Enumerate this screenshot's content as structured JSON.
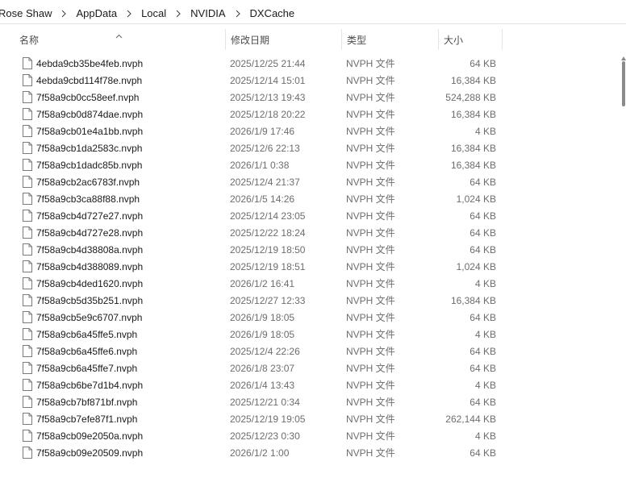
{
  "breadcrumb": [
    "Rose Shaw",
    "AppData",
    "Local",
    "NVIDIA",
    "DXCache"
  ],
  "columns": {
    "name": "名称",
    "date": "修改日期",
    "type": "类型",
    "size": "大小"
  },
  "files": [
    {
      "name": "4ebda9cb35be4feb.nvph",
      "date": "2025/12/25 21:44",
      "type": "NVPH 文件",
      "size": "64 KB"
    },
    {
      "name": "4ebda9cbd114f78e.nvph",
      "date": "2025/12/14 15:01",
      "type": "NVPH 文件",
      "size": "16,384 KB"
    },
    {
      "name": "7f58a9cb0cc58eef.nvph",
      "date": "2025/12/13 19:43",
      "type": "NVPH 文件",
      "size": "524,288 KB"
    },
    {
      "name": "7f58a9cb0d874dae.nvph",
      "date": "2025/12/18 20:22",
      "type": "NVPH 文件",
      "size": "16,384 KB"
    },
    {
      "name": "7f58a9cb01e4a1bb.nvph",
      "date": "2026/1/9 17:46",
      "type": "NVPH 文件",
      "size": "4 KB"
    },
    {
      "name": "7f58a9cb1da2583c.nvph",
      "date": "2025/12/6 22:13",
      "type": "NVPH 文件",
      "size": "16,384 KB"
    },
    {
      "name": "7f58a9cb1dadc85b.nvph",
      "date": "2026/1/1 0:38",
      "type": "NVPH 文件",
      "size": "16,384 KB"
    },
    {
      "name": "7f58a9cb2ac6783f.nvph",
      "date": "2025/12/4 21:37",
      "type": "NVPH 文件",
      "size": "64 KB"
    },
    {
      "name": "7f58a9cb3ca88f88.nvph",
      "date": "2026/1/5 14:26",
      "type": "NVPH 文件",
      "size": "1,024 KB"
    },
    {
      "name": "7f58a9cb4d727e27.nvph",
      "date": "2025/12/14 23:05",
      "type": "NVPH 文件",
      "size": "64 KB"
    },
    {
      "name": "7f58a9cb4d727e28.nvph",
      "date": "2025/12/22 18:24",
      "type": "NVPH 文件",
      "size": "64 KB"
    },
    {
      "name": "7f58a9cb4d38808a.nvph",
      "date": "2025/12/19 18:50",
      "type": "NVPH 文件",
      "size": "64 KB"
    },
    {
      "name": "7f58a9cb4d388089.nvph",
      "date": "2025/12/19 18:51",
      "type": "NVPH 文件",
      "size": "1,024 KB"
    },
    {
      "name": "7f58a9cb4ded1620.nvph",
      "date": "2026/1/2 16:41",
      "type": "NVPH 文件",
      "size": "4 KB"
    },
    {
      "name": "7f58a9cb5d35b251.nvph",
      "date": "2025/12/27 12:33",
      "type": "NVPH 文件",
      "size": "16,384 KB"
    },
    {
      "name": "7f58a9cb5e9c6707.nvph",
      "date": "2026/1/9 18:05",
      "type": "NVPH 文件",
      "size": "64 KB"
    },
    {
      "name": "7f58a9cb6a45ffe5.nvph",
      "date": "2026/1/9 18:05",
      "type": "NVPH 文件",
      "size": "4 KB"
    },
    {
      "name": "7f58a9cb6a45ffe6.nvph",
      "date": "2025/12/4 22:26",
      "type": "NVPH 文件",
      "size": "64 KB"
    },
    {
      "name": "7f58a9cb6a45ffe7.nvph",
      "date": "2026/1/8 23:07",
      "type": "NVPH 文件",
      "size": "64 KB"
    },
    {
      "name": "7f58a9cb6be7d1b4.nvph",
      "date": "2026/1/4 13:43",
      "type": "NVPH 文件",
      "size": "4 KB"
    },
    {
      "name": "7f58a9cb7bf871bf.nvph",
      "date": "2025/12/21 0:34",
      "type": "NVPH 文件",
      "size": "64 KB"
    },
    {
      "name": "7f58a9cb7efe87f1.nvph",
      "date": "2025/12/19 19:05",
      "type": "NVPH 文件",
      "size": "262,144 KB"
    },
    {
      "name": "7f58a9cb09e2050a.nvph",
      "date": "2025/12/23 0:30",
      "type": "NVPH 文件",
      "size": "4 KB"
    },
    {
      "name": "7f58a9cb09e20509.nvph",
      "date": "2026/1/2 1:00",
      "type": "NVPH 文件",
      "size": "64 KB"
    }
  ]
}
